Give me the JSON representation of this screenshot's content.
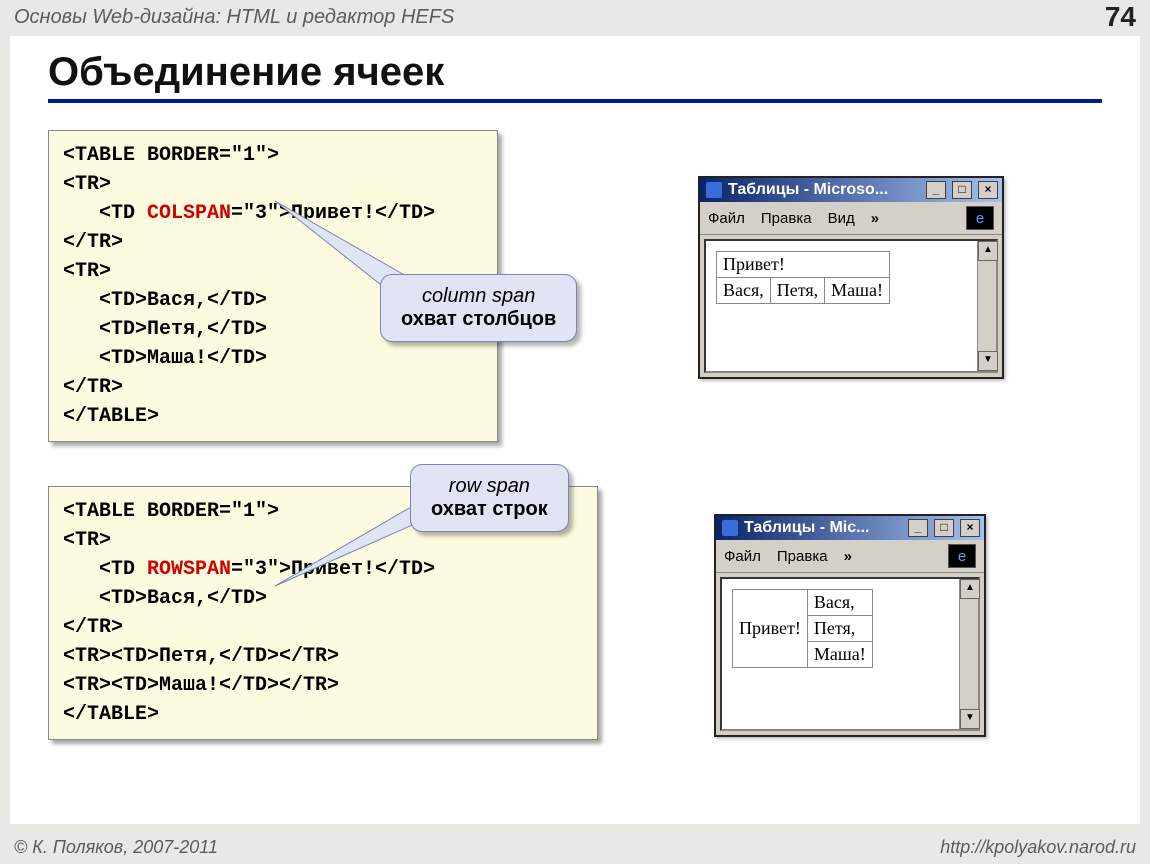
{
  "header": {
    "title": "Основы Web-дизайна: HTML и редактор HEFS",
    "page": "74"
  },
  "slide_title": "Объединение ячеек",
  "code1": {
    "l1": "<TABLE BORDER=\"1\">",
    "l2": "<TR>",
    "l3a": "   <TD ",
    "l3red": "COLSPAN",
    "l3b": "=\"3\">Привет!</TD>",
    "l4": "</TR>",
    "l5": "<TR>",
    "l6": "   <TD>Вася,</TD>",
    "l7": "   <TD>Петя,</TD>",
    "l8": "   <TD>Маша!</TD>",
    "l9": "</TR>",
    "l10": "</TABLE>"
  },
  "callout1": {
    "en": "column span",
    "ru": "охват столбцов"
  },
  "code2": {
    "l1": "<TABLE BORDER=\"1\">",
    "l2": "<TR>",
    "l3a": "   <TD ",
    "l3red": "ROWSPAN",
    "l3b": "=\"3\">Привет!</TD>",
    "l4": "   <TD>Вася,</TD>",
    "l5": "</TR>",
    "l6": "<TR><TD>Петя,</TD></TR>",
    "l7": "<TR><TD>Маша!</TD></TR>",
    "l8": "</TABLE>"
  },
  "callout2": {
    "en": "row span",
    "ru": "охват строк"
  },
  "win1": {
    "title": "Таблицы - Microso...",
    "menu": [
      "Файл",
      "Правка",
      "Вид"
    ],
    "chev": "»",
    "row1": "Привет!",
    "row2": [
      "Вася,",
      "Петя,",
      "Маша!"
    ]
  },
  "win2": {
    "title": "Таблицы - Mic...",
    "menu": [
      "Файл",
      "Правка"
    ],
    "chev": "»",
    "colspan_cell": "Привет!",
    "rows": [
      "Вася,",
      "Петя,",
      "Маша!"
    ]
  },
  "winbtns": {
    "min": "_",
    "max": "□",
    "close": "×"
  },
  "footer": {
    "left": "© К. Поляков, 2007-2011",
    "right": "http://kpolyakov.narod.ru"
  }
}
